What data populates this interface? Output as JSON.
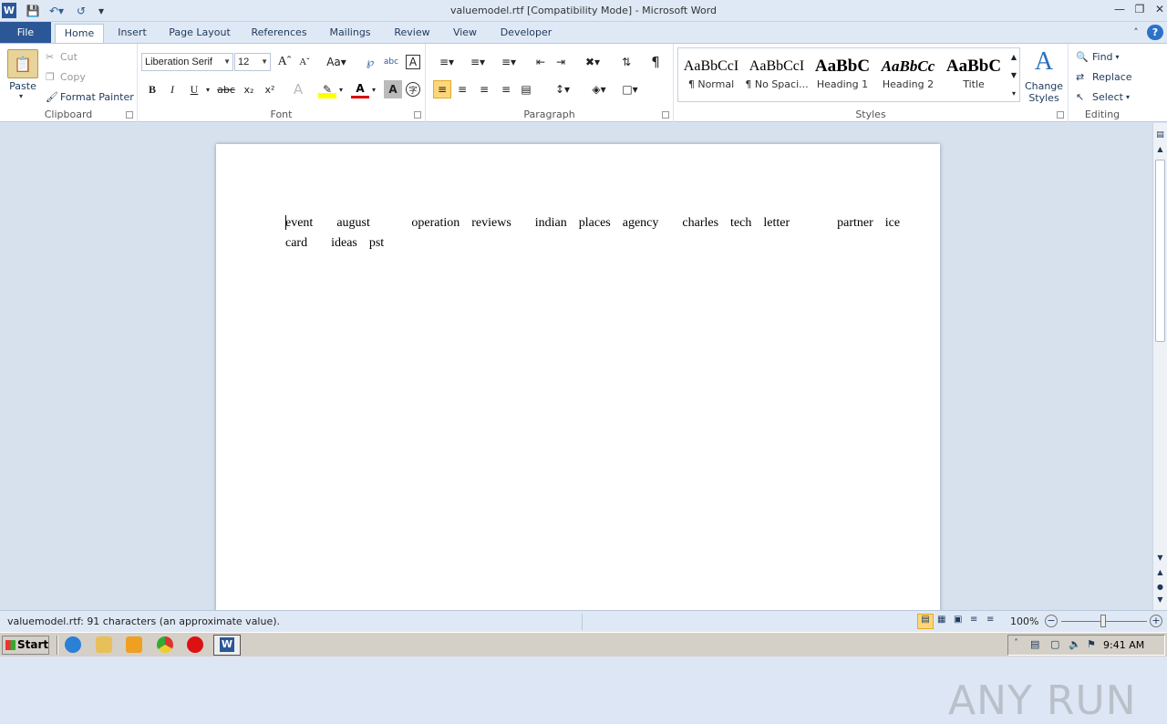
{
  "window": {
    "title": "valuemodel.rtf [Compatibility Mode]  -  Microsoft Word"
  },
  "qat": {
    "app_icon": "W",
    "save_icon": "save-icon",
    "undo_icon": "undo-icon",
    "redo_icon": "redo-icon"
  },
  "tabs": [
    "File",
    "Home",
    "Insert",
    "Page Layout",
    "References",
    "Mailings",
    "Review",
    "View",
    "Developer"
  ],
  "clipboard": {
    "paste": "Paste",
    "cut": "Cut",
    "copy": "Copy",
    "format_painter": "Format Painter",
    "label": "Clipboard"
  },
  "font": {
    "name": "Liberation Serif",
    "size": "12",
    "label": "Font"
  },
  "paragraph": {
    "label": "Paragraph"
  },
  "styles": {
    "items": [
      {
        "preview": "AaBbCcI",
        "name": "¶ Normal"
      },
      {
        "preview": "AaBbCcI",
        "name": "¶ No Spaci..."
      },
      {
        "preview": "AaBbC",
        "name": "Heading 1"
      },
      {
        "preview": "AaBbCc",
        "name": "Heading 2"
      },
      {
        "preview": "AaBbC",
        "name": "Title"
      }
    ],
    "change": "Change Styles",
    "label": "Styles"
  },
  "editing": {
    "find": "Find",
    "replace": "Replace",
    "select": "Select",
    "label": "Editing"
  },
  "document": {
    "line1": "event    august       operation  reviews    indian  places  agency    charles  tech  letter        partner  ice",
    "line2": "card    ideas  pst"
  },
  "status": {
    "text": "valuemodel.rtf: 91 characters (an approximate value).",
    "zoom": "100%"
  },
  "taskbar": {
    "start": "Start",
    "time": "9:41 AM"
  },
  "watermark": "ANY RUN"
}
